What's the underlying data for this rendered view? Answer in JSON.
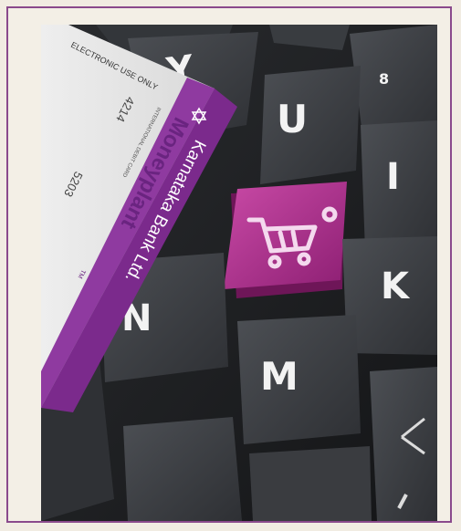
{
  "photo": {
    "keys": {
      "y": "Y",
      "u": "U",
      "i": "I",
      "eight": "8",
      "k": "K",
      "n": "N",
      "m": "M"
    },
    "card": {
      "electronic_use": "ELECTRONIC USE ONLY",
      "brand": "Moneyplant",
      "tm": "TM",
      "debit_card": "INTERNATIONAL DEBIT CARD",
      "number_a": "4214",
      "number_b": "5203",
      "bank": "Karnataka Bank Ltd."
    }
  },
  "colors": {
    "frame": "#8a4a8c",
    "frame_bg": "#f3efe6",
    "key": "#3a3d41",
    "cart_key": "#b0318f",
    "card_purple": "#7b2a8c"
  },
  "icons": [
    "shopping-cart-icon",
    "karnataka-bank-emblem-icon"
  ]
}
